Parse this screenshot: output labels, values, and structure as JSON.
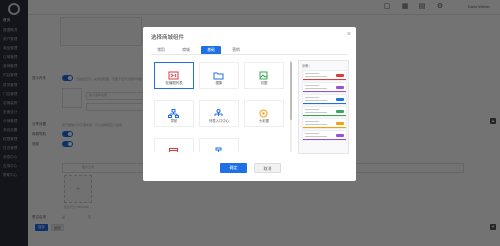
{
  "sidebar": {
    "items": [
      {
        "label": "首页"
      },
      {
        "label": "数据概况"
      },
      {
        "label": "用户管理"
      },
      {
        "label": "商品管理"
      },
      {
        "label": "订单管理"
      },
      {
        "label": "营销管理"
      },
      {
        "label": "内容管理"
      },
      {
        "label": "财务管理"
      },
      {
        "label": "门店管理"
      },
      {
        "label": "店铺装修"
      },
      {
        "label": "页面设计"
      },
      {
        "label": "分销管理"
      },
      {
        "label": "系统设置"
      },
      {
        "label": "权限管理"
      },
      {
        "label": "日志管理"
      },
      {
        "label": "消息中心"
      },
      {
        "label": "应用中心"
      },
      {
        "label": "帮助中心"
      }
    ]
  },
  "topbar": {
    "user": "Dario Weber"
  },
  "background": {
    "row1_label": "显示开关",
    "row1_hint": "开启后显示，关闭后隐藏，页面不显示该组件内容",
    "placeholder_line": "输入组件名称",
    "row2_label": "分享设置",
    "row2_hint": "用于微信分享及朋友圈，可以选择自定义设置",
    "toggle_a": "商城导航",
    "toggle_b": "底部",
    "upload_label": "图片上传",
    "upload_hint": "建议尺寸 750×350",
    "bottom_label": "是否启用",
    "radio_a": "是",
    "radio_b": "否",
    "save_btn": "保存",
    "back_btn": "返回"
  },
  "modal": {
    "title": "选择商城组件",
    "tabs": [
      {
        "label": "常用",
        "active": false
      },
      {
        "label": "商城",
        "active": false
      },
      {
        "label": "基础",
        "active": true
      },
      {
        "label": "营销",
        "active": false
      }
    ],
    "components": [
      {
        "label": "轮播图列表",
        "icon": "slideshow-icon",
        "color": "#e0393e",
        "selected": true
      },
      {
        "label": "图集",
        "icon": "folder-icon",
        "color": "#1f6fe5",
        "selected": false
      },
      {
        "label": "切图",
        "icon": "image-icon",
        "color": "#3aa65a",
        "selected": false
      },
      {
        "label": "导航",
        "icon": "network-icon",
        "color": "#1f6fe5",
        "selected": false
      },
      {
        "label": "列表入口中心",
        "icon": "org-chart-icon",
        "color": "#1f6fe5",
        "selected": false
      },
      {
        "label": "七彩图",
        "icon": "color-wheel-icon",
        "color": "#f2a20d",
        "selected": false
      },
      {
        "label": "",
        "icon": "card-icon",
        "color": "#e0393e",
        "selected": false
      },
      {
        "label": "",
        "icon": "hammer-icon",
        "color": "#1f6fe5",
        "selected": false
      }
    ],
    "preview_title": "示例：",
    "preview_cards": [
      {
        "tag_color": "#e0393e",
        "bar_color": "#e0393e"
      },
      {
        "tag_color": "#9c4fd8",
        "bar_color": "#9c4fd8"
      },
      {
        "tag_color": "#1f6fe5",
        "bar_color": "#1f6fe5"
      },
      {
        "tag_color": "#3aa65a",
        "bar_color": "#3aa65a"
      },
      {
        "tag_color": "#f2a20d",
        "bar_color": "#f2a20d"
      },
      {
        "tag_color": "#9c4fd8",
        "bar_color": "#9c4fd8"
      }
    ],
    "ok_label": "确定",
    "cancel_label": "取消"
  },
  "colors": {
    "accent": "#1f6fe5",
    "overlay": "rgba(0,0,0,0.55)"
  }
}
